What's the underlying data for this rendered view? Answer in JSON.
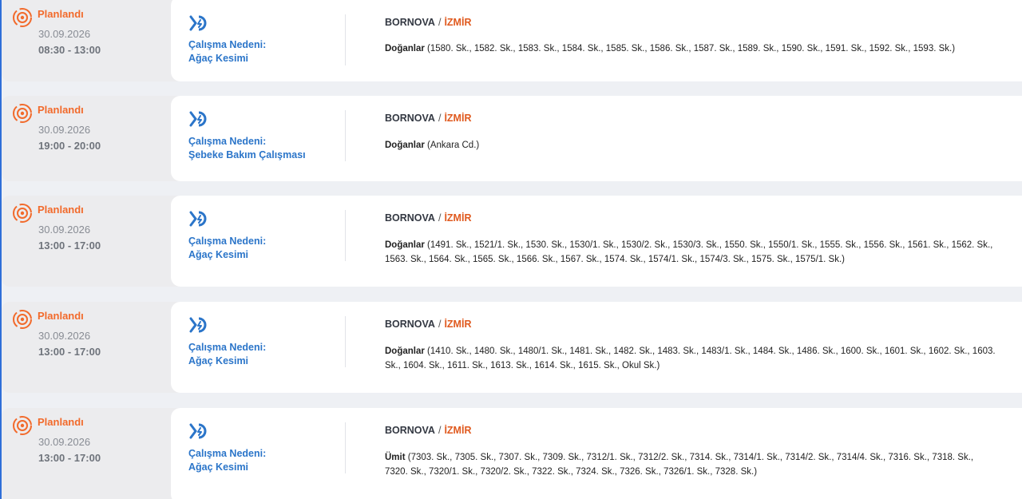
{
  "theme": {
    "status_color": "#f26a2b",
    "reason_color": "#2b75c9",
    "city_color": "#e05a1f"
  },
  "outages": [
    {
      "status": "Planlandı",
      "date": "30.09.2026",
      "time": "08:30 - 13:00",
      "reason_title": "Çalışma Nedeni:",
      "reason": "Ağaç Kesimi",
      "district": "BORNOVA",
      "separator": "/",
      "city": "İZMİR",
      "neighborhood": "Doğanlar",
      "street_lines": [
        " (1580. Sk., 1582. Sk., 1583. Sk., 1584. Sk., 1585. Sk., 1586. Sk., 1587. Sk., 1589. Sk., 1590. Sk., 1591. Sk., 1592. Sk., 1593. Sk.)"
      ]
    },
    {
      "status": "Planlandı",
      "date": "30.09.2026",
      "time": "19:00 - 20:00",
      "reason_title": "Çalışma Nedeni:",
      "reason": "Şebeke Bakım Çalışması",
      "district": "BORNOVA",
      "separator": "/",
      "city": "İZMİR",
      "neighborhood": "Doğanlar",
      "street_lines": [
        " (Ankara Cd.)"
      ]
    },
    {
      "status": "Planlandı",
      "date": "30.09.2026",
      "time": "13:00 - 17:00",
      "reason_title": "Çalışma Nedeni:",
      "reason": "Ağaç Kesimi",
      "district": "BORNOVA",
      "separator": "/",
      "city": "İZMİR",
      "neighborhood": "Doğanlar",
      "street_lines": [
        " (1491. Sk., 1521/1. Sk., 1530. Sk., 1530/1. Sk., 1530/2. Sk., 1530/3. Sk., 1550. Sk., 1550/1. Sk., 1555. Sk., 1556. Sk., 1561. Sk., 1562. Sk.,",
        "1563. Sk., 1564. Sk., 1565. Sk., 1566. Sk., 1567. Sk., 1574. Sk., 1574/1. Sk., 1574/3. Sk., 1575. Sk., 1575/1. Sk.)"
      ]
    },
    {
      "status": "Planlandı",
      "date": "30.09.2026",
      "time": "13:00 - 17:00",
      "reason_title": "Çalışma Nedeni:",
      "reason": "Ağaç Kesimi",
      "district": "BORNOVA",
      "separator": "/",
      "city": "İZMİR",
      "neighborhood": "Doğanlar",
      "street_lines": [
        " (1410. Sk., 1480. Sk., 1480/1. Sk., 1481. Sk., 1482. Sk., 1483. Sk., 1483/1. Sk., 1484. Sk., 1486. Sk., 1600. Sk., 1601. Sk., 1602. Sk., 1603.",
        "Sk., 1604. Sk., 1611. Sk., 1613. Sk., 1614. Sk., 1615. Sk., Okul Sk.)"
      ]
    },
    {
      "status": "Planlandı",
      "date": "30.09.2026",
      "time": "13:00 - 17:00",
      "reason_title": "Çalışma Nedeni:",
      "reason": "Ağaç Kesimi",
      "district": "BORNOVA",
      "separator": "/",
      "city": "İZMİR",
      "neighborhood": "Ümit",
      "street_lines": [
        " (7303. Sk., 7305. Sk., 7307. Sk., 7309. Sk., 7312/1. Sk., 7312/2. Sk., 7314. Sk., 7314/1. Sk., 7314/2. Sk., 7314/4. Sk., 7316. Sk., 7318. Sk.,",
        "7320. Sk., 7320/1. Sk., 7320/2. Sk., 7322. Sk., 7324. Sk., 7326. Sk., 7326/1. Sk., 7328. Sk.)"
      ]
    }
  ]
}
